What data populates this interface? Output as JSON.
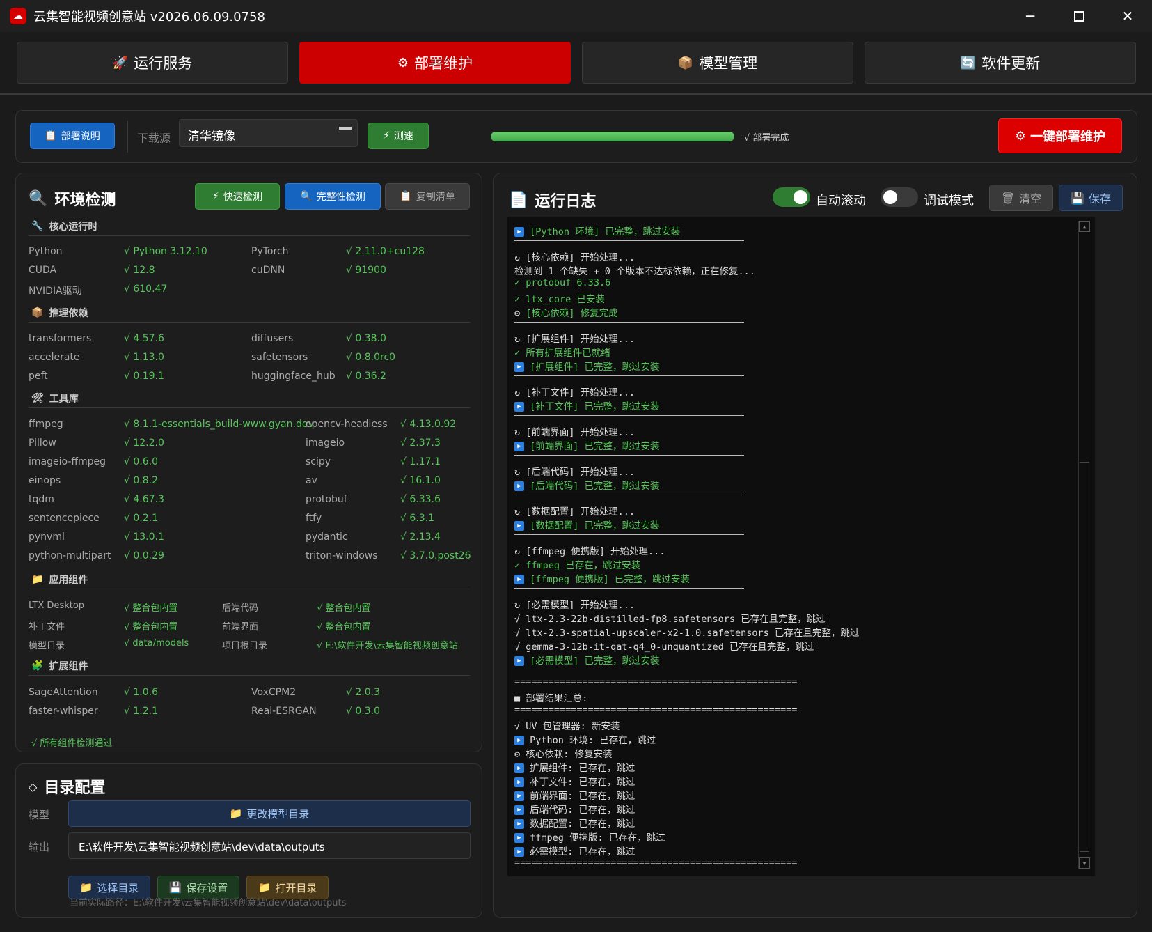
{
  "window": {
    "title": "云集智能视频创意站 v2026.06.09.0758",
    "minimize": "─",
    "close": "✕"
  },
  "tabs": [
    {
      "label": "运行服务",
      "icon": "🚀"
    },
    {
      "label": "部署维护",
      "icon": "⚙"
    },
    {
      "label": "模型管理",
      "icon": "📦"
    },
    {
      "label": "软件更新",
      "icon": "🔄"
    }
  ],
  "toolbar": {
    "doc_button": "部署说明",
    "download_source_label": "下载源",
    "download_source_value": "清华镜像",
    "speed_test_button": "测速",
    "progress_value": 1.0,
    "progress_label": "√ 部署完成",
    "deploy_button": "一键部署维护"
  },
  "env": {
    "title": "环境检测",
    "quick_check": "快速检测",
    "full_check": "完整性检测",
    "copy_list": "复制清单",
    "sections": {
      "core": "核心运行时",
      "infer": "推理依赖",
      "tools": "工具库",
      "apps": "应用组件",
      "ext": "扩展组件"
    },
    "core": [
      {
        "k": "Python",
        "v": "√ Python 3.12.10"
      },
      {
        "k": "PyTorch",
        "v": "√ 2.11.0+cu128"
      },
      {
        "k": "CUDA",
        "v": "√ 12.8"
      },
      {
        "k": "cuDNN",
        "v": "√ 91900"
      },
      {
        "k": "NVIDIA驱动",
        "v": "√ 610.47"
      }
    ],
    "infer": [
      {
        "k": "transformers",
        "v": "√ 4.57.6"
      },
      {
        "k": "diffusers",
        "v": "√ 0.38.0"
      },
      {
        "k": "accelerate",
        "v": "√ 1.13.0"
      },
      {
        "k": "safetensors",
        "v": "√ 0.8.0rc0"
      },
      {
        "k": "peft",
        "v": "√ 0.19.1"
      },
      {
        "k": "huggingface_hub",
        "v": "√ 0.36.2"
      }
    ],
    "tools": [
      {
        "k": "ffmpeg",
        "v": "√ 8.1.1-essentials_build-www.gyan.dev"
      },
      {
        "k": "opencv-headless",
        "v": "√ 4.13.0.92"
      },
      {
        "k": "Pillow",
        "v": "√ 12.2.0"
      },
      {
        "k": "imageio",
        "v": "√ 2.37.3"
      },
      {
        "k": "imageio-ffmpeg",
        "v": "√ 0.6.0"
      },
      {
        "k": "scipy",
        "v": "√ 1.17.1"
      },
      {
        "k": "einops",
        "v": "√ 0.8.2"
      },
      {
        "k": "av",
        "v": "√ 16.1.0"
      },
      {
        "k": "tqdm",
        "v": "√ 4.67.3"
      },
      {
        "k": "protobuf",
        "v": "√ 6.33.6"
      },
      {
        "k": "sentencepiece",
        "v": "√ 0.2.1"
      },
      {
        "k": "ftfy",
        "v": "√ 6.3.1"
      },
      {
        "k": "pynvml",
        "v": "√ 13.0.1"
      },
      {
        "k": "pydantic",
        "v": "√ 2.13.4"
      },
      {
        "k": "python-multipart",
        "v": "√ 0.0.29"
      },
      {
        "k": "triton-windows",
        "v": "√ 3.7.0.post26"
      }
    ],
    "apps": [
      {
        "k": "LTX Desktop",
        "v": "√ 整合包内置"
      },
      {
        "k": "后端代码",
        "v": "√ 整合包内置"
      },
      {
        "k": "补丁文件",
        "v": "√ 整合包内置"
      },
      {
        "k": "前端界面",
        "v": "√ 整合包内置"
      },
      {
        "k": "模型目录",
        "v": "√ data/models"
      },
      {
        "k": "项目根目录",
        "v": "√ E:\\软件开发\\云集智能视频创意站"
      }
    ],
    "ext": [
      {
        "k": "SageAttention",
        "v": "√ 1.0.6"
      },
      {
        "k": "VoxCPM2",
        "v": "√ 2.0.3"
      },
      {
        "k": "faster-whisper",
        "v": "√ 1.2.1"
      },
      {
        "k": "Real-ESRGAN",
        "v": "√ 0.3.0"
      }
    ],
    "footer": "√ 所有组件检测通过"
  },
  "dirs": {
    "title": "目录配置",
    "model_label": "模型",
    "change_model_dir": "更改模型目录",
    "output_label": "输出",
    "output_value": "E:\\软件开发\\云集智能视频创意站\\dev\\data\\outputs",
    "choose_dir": "选择目录",
    "save_settings": "保存设置",
    "open_dir": "打开目录",
    "current_path": "当前实际路径：E:\\软件开发\\云集智能视频创意站\\dev\\data\\outputs"
  },
  "log": {
    "title": "运行日志",
    "auto_scroll_label": "自动滚动",
    "auto_scroll_on": true,
    "debug_label": "调试模式",
    "debug_on": false,
    "clear_button": "清空",
    "save_button": "保存",
    "lines": [
      {
        "t": "[Python 环境] 已完整，跳过安装",
        "c": "green",
        "i": "skip"
      },
      {
        "t": "div"
      },
      {
        "t": "[核心依赖] 开始处理...",
        "c": "white",
        "i": "loop"
      },
      {
        "t": "检测到 1 个缺失 + 0 个版本不达标依赖，正在修复...",
        "c": "white",
        "i": ""
      },
      {
        "t": "protobuf 6.33.6",
        "c": "green",
        "i": "check"
      },
      {
        "t": "ltx_core 已安装",
        "c": "green",
        "i": "check"
      },
      {
        "t": "[核心依赖] 修复完成",
        "c": "green",
        "i": "gear"
      },
      {
        "t": "div"
      },
      {
        "t": "[扩展组件] 开始处理...",
        "c": "white",
        "i": "loop"
      },
      {
        "t": "所有扩展组件已就绪",
        "c": "green",
        "i": "check"
      },
      {
        "t": "[扩展组件] 已完整，跳过安装",
        "c": "green",
        "i": "skip"
      },
      {
        "t": "div"
      },
      {
        "t": "[补丁文件] 开始处理...",
        "c": "white",
        "i": "loop"
      },
      {
        "t": "[补丁文件] 已完整，跳过安装",
        "c": "green",
        "i": "skip"
      },
      {
        "t": "div"
      },
      {
        "t": "[前端界面] 开始处理...",
        "c": "white",
        "i": "loop"
      },
      {
        "t": "[前端界面] 已完整，跳过安装",
        "c": "green",
        "i": "skip"
      },
      {
        "t": "div"
      },
      {
        "t": "[后端代码] 开始处理...",
        "c": "white",
        "i": "loop"
      },
      {
        "t": "[后端代码] 已完整，跳过安装",
        "c": "green",
        "i": "skip"
      },
      {
        "t": "div"
      },
      {
        "t": "[数据配置] 开始处理...",
        "c": "white",
        "i": "loop"
      },
      {
        "t": "[数据配置] 已完整，跳过安装",
        "c": "green",
        "i": "skip"
      },
      {
        "t": "div"
      },
      {
        "t": "[ffmpeg 便携版] 开始处理...",
        "c": "white",
        "i": "loop"
      },
      {
        "t": "ffmpeg 已存在，跳过安装",
        "c": "green",
        "i": "check"
      },
      {
        "t": "[ffmpeg 便携版] 已完整，跳过安装",
        "c": "green",
        "i": "skip"
      },
      {
        "t": "div"
      },
      {
        "t": "[必需模型] 开始处理...",
        "c": "white",
        "i": "loop"
      },
      {
        "t": "√ ltx-2.3-22b-distilled-fp8.safetensors 已存在且完整，跳过",
        "c": "white",
        "i": ""
      },
      {
        "t": "√ ltx-2.3-spatial-upscaler-x2-1.0.safetensors 已存在且完整，跳过",
        "c": "white",
        "i": ""
      },
      {
        "t": "√ gemma-3-12b-it-qat-q4_0-unquantized 已存在且完整，跳过",
        "c": "white",
        "i": ""
      },
      {
        "t": "[必需模型] 已完整，跳过安装",
        "c": "green",
        "i": "skip"
      },
      {
        "t": "blank"
      },
      {
        "t": "==================================================",
        "c": "white",
        "i": ""
      },
      {
        "t": "■ 部署结果汇总:",
        "c": "white",
        "i": ""
      },
      {
        "t": "==================================================",
        "c": "white",
        "i": ""
      },
      {
        "t": "√ UV 包管理器: 新安装",
        "c": "white",
        "i": ""
      },
      {
        "t": "Python 环境: 已存在，跳过",
        "c": "white",
        "i": "skip"
      },
      {
        "t": "核心依赖: 修复安装",
        "c": "white",
        "i": "gear"
      },
      {
        "t": "扩展组件: 已存在，跳过",
        "c": "white",
        "i": "skip"
      },
      {
        "t": "补丁文件: 已存在，跳过",
        "c": "white",
        "i": "skip"
      },
      {
        "t": "前端界面: 已存在，跳过",
        "c": "white",
        "i": "skip"
      },
      {
        "t": "后端代码: 已存在，跳过",
        "c": "white",
        "i": "skip"
      },
      {
        "t": "数据配置: 已存在，跳过",
        "c": "white",
        "i": "skip"
      },
      {
        "t": "ffmpeg 便携版: 已存在，跳过",
        "c": "white",
        "i": "skip"
      },
      {
        "t": "必需模型: 已存在，跳过",
        "c": "white",
        "i": "skip"
      },
      {
        "t": "==================================================",
        "c": "white",
        "i": ""
      }
    ]
  },
  "colors": {
    "accent": "#cc0000",
    "ok": "#57c75a",
    "blue": "#1565c0"
  }
}
